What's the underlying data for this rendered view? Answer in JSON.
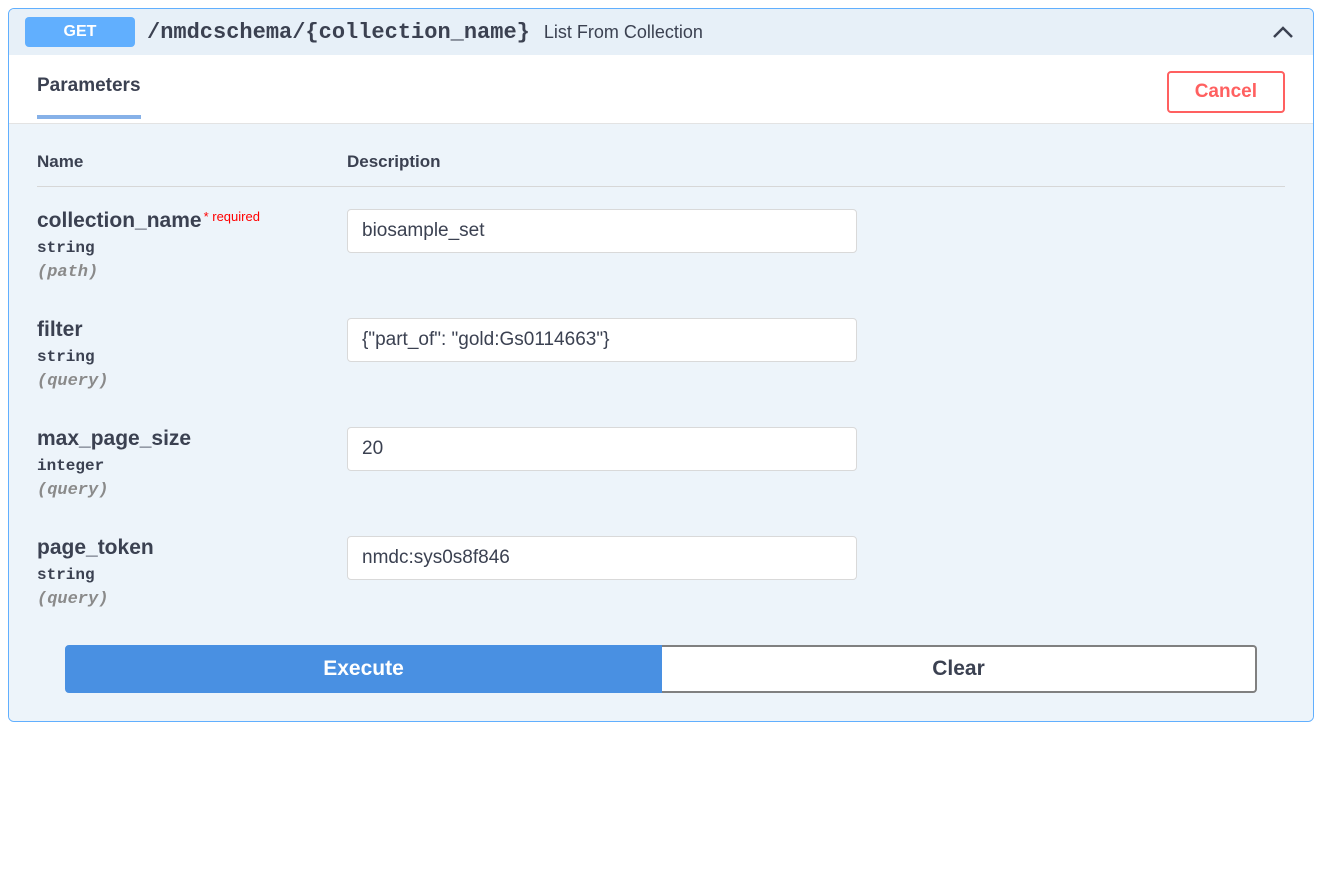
{
  "endpoint": {
    "method": "GET",
    "path": "/nmdcschema/{collection_name}",
    "summary": "List From Collection"
  },
  "tabs": {
    "parameters": "Parameters"
  },
  "buttons": {
    "cancel": "Cancel",
    "execute": "Execute",
    "clear": "Clear"
  },
  "columns": {
    "name": "Name",
    "description": "Description"
  },
  "params": [
    {
      "name": "collection_name",
      "required": "* required",
      "type": "string",
      "in": "(path)",
      "value": "biosample_set"
    },
    {
      "name": "filter",
      "required": "",
      "type": "string",
      "in": "(query)",
      "value": "{\"part_of\": \"gold:Gs0114663\"}"
    },
    {
      "name": "max_page_size",
      "required": "",
      "type": "integer",
      "in": "(query)",
      "value": "20"
    },
    {
      "name": "page_token",
      "required": "",
      "type": "string",
      "in": "(query)",
      "value": "nmdc:sys0s8f846"
    }
  ]
}
